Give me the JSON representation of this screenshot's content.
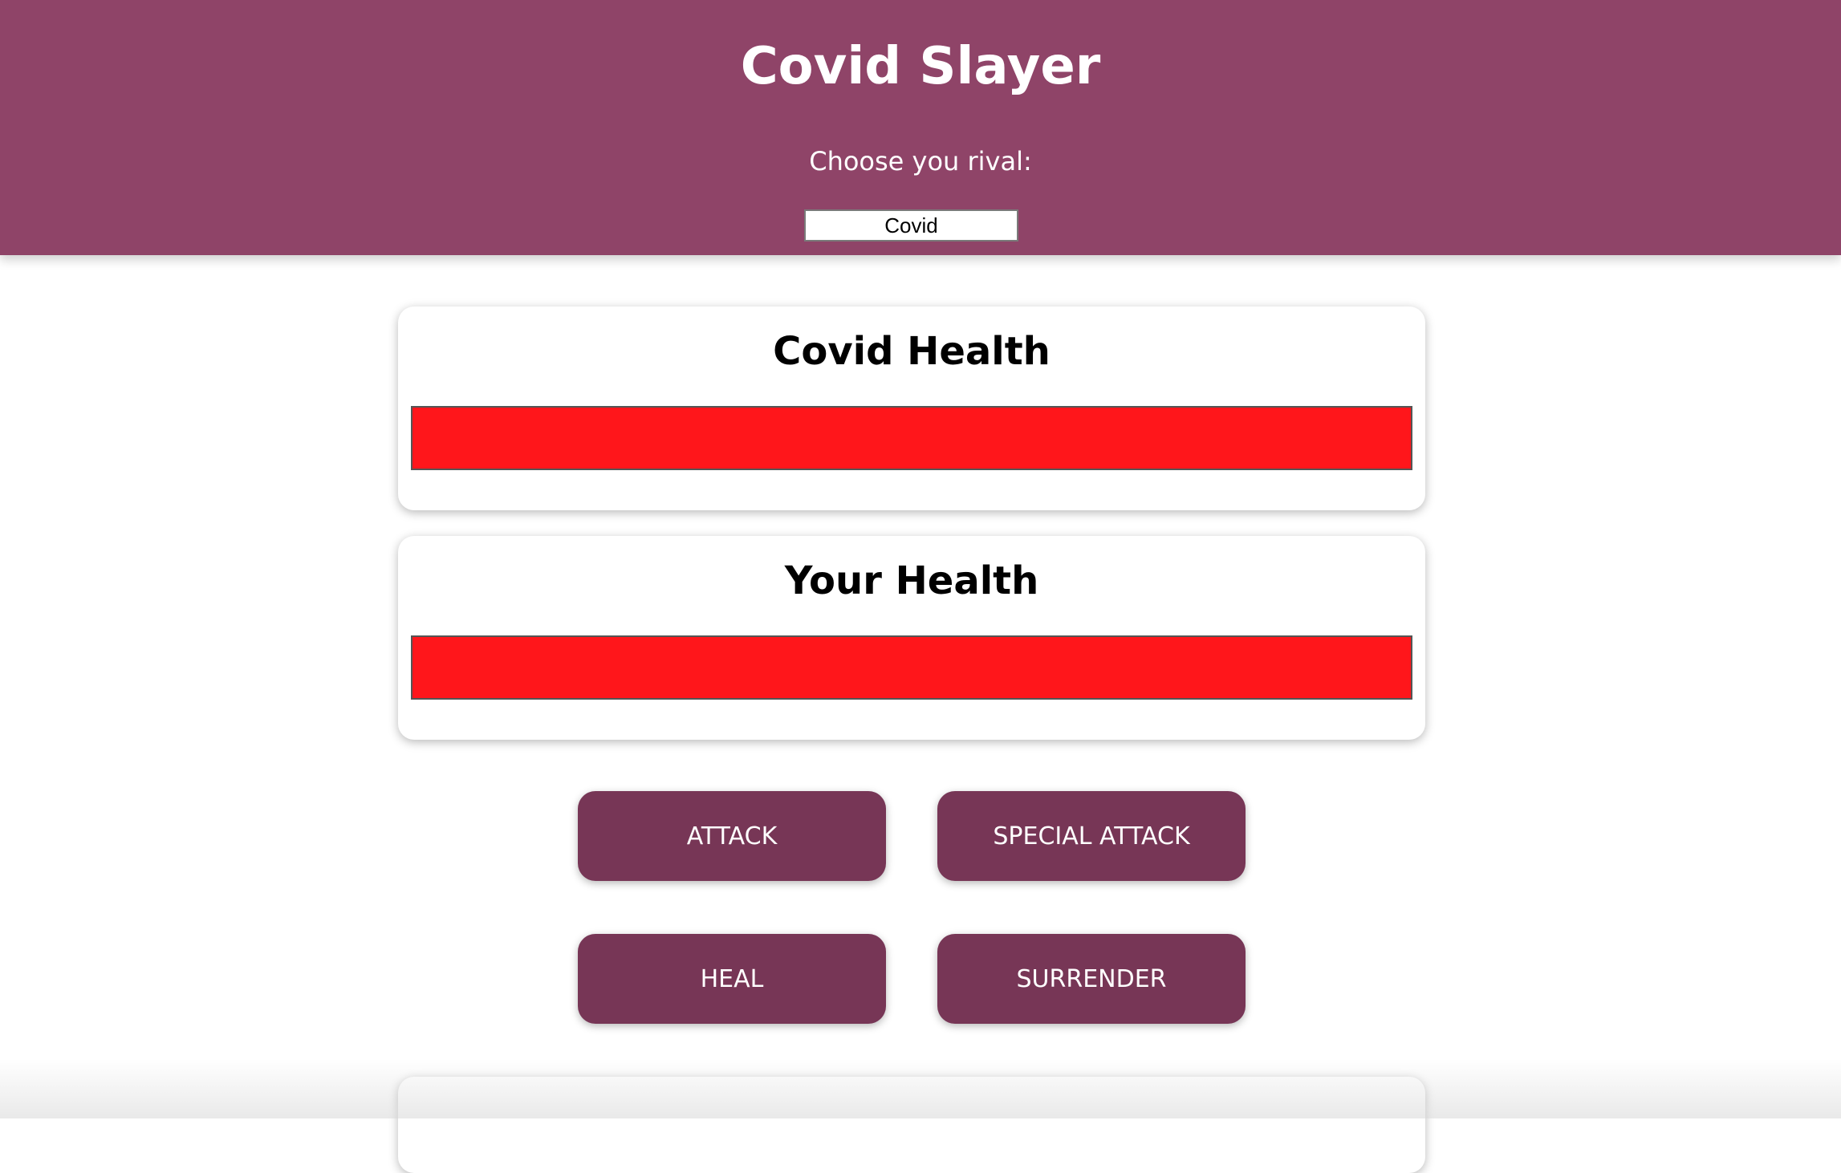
{
  "header": {
    "title": "Covid Slayer",
    "rival_label": "Choose you rival:",
    "rival_value": "Covid"
  },
  "monster": {
    "title": "Covid Health",
    "health_percent": 100
  },
  "player": {
    "title": "Your Health",
    "health_percent": 100
  },
  "controls": {
    "attack": "ATTACK",
    "special_attack": "SPECIAL ATTACK",
    "heal": "HEAL",
    "surrender": "SURRENDER"
  },
  "colors": {
    "header_bg": "#8f4468",
    "button_bg": "#773656",
    "health_fill": "#ff161b"
  }
}
